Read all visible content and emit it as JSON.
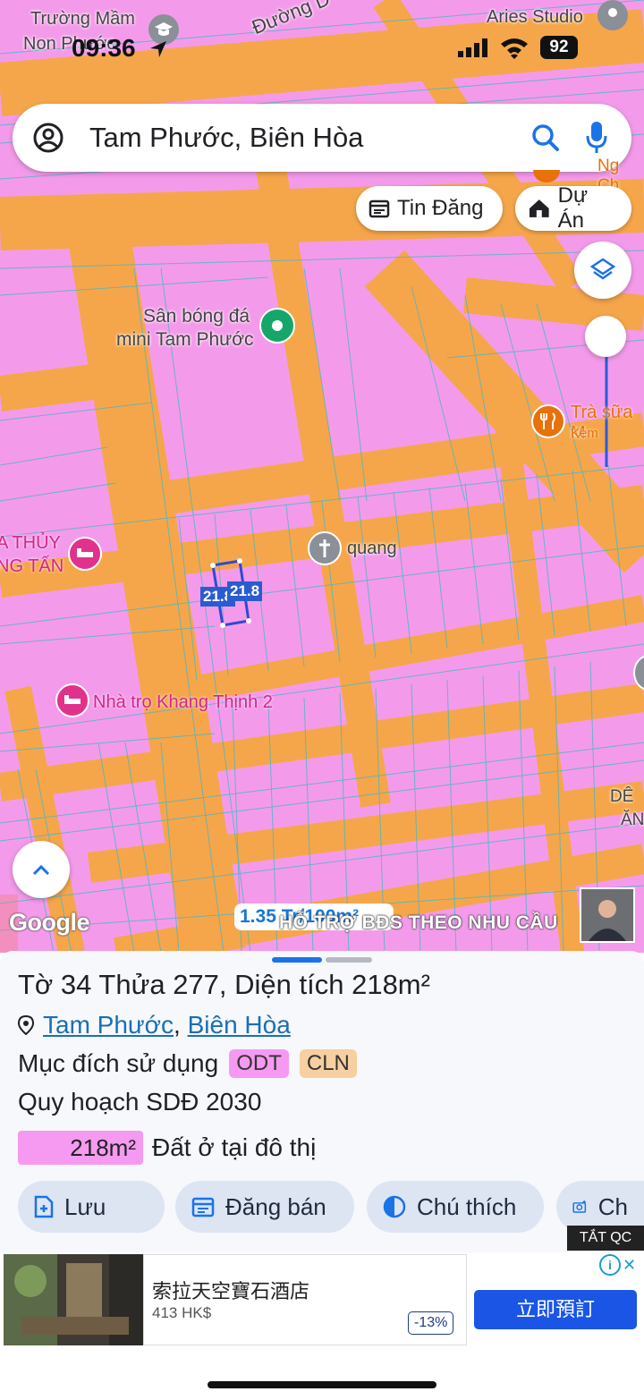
{
  "status": {
    "time": "09:36",
    "battery": "92"
  },
  "search": {
    "query": "Tam Phước, Biên Hòa"
  },
  "chips": {
    "listings": "Tin Đăng",
    "projects": "Dự Án"
  },
  "map": {
    "labels": {
      "school": "Trường Mầm",
      "school2": "Non Phước",
      "road": "Đường D",
      "studio": "Aries Studio",
      "field1": "Sân bóng đá",
      "field2": "mini Tam Phước",
      "tea1": "Trà sữa M",
      "tea2": "Kem",
      "thuy1": "A THỦY",
      "thuy2": "NG TẤN",
      "church": "quang",
      "motel": "Nhà trọ Khang Thịnh 2",
      "cut_right": "Ng Ch",
      "de1": "DÊ",
      "de2": "ĂN",
      "dim1": "21.8",
      "dim2": "21.8"
    },
    "google": "Google",
    "scale_text": "1.35 Tr/100m²",
    "watermark": "HỖ TRỢ BĐS  THEO NHU CẦU"
  },
  "sheet": {
    "title": "Tờ 34 Thửa 277, Diện tích 218m²",
    "ward": "Tam Phước",
    "city": "Biên Hòa",
    "purpose_label": "Mục đích sử dụng",
    "badge1": "ODT",
    "badge2": "CLN",
    "plan": "Quy hoạch SDĐ 2030",
    "area_value": "218m²",
    "area_desc": "Đất ở tại đô thị",
    "actions": {
      "save": "Lưu",
      "post": "Đăng bán",
      "legend": "Chú thích",
      "capture": "Ch"
    }
  },
  "ad": {
    "tag": "TẮT QC",
    "hotel": "索拉天空寶石酒店",
    "price": "413 HK$",
    "discount": "-13%",
    "cta": "立即預訂"
  },
  "colors": {
    "land": "#f39bea",
    "road": "#f5a64a",
    "accent": "#1a73e8",
    "cta": "#1a55e6"
  }
}
